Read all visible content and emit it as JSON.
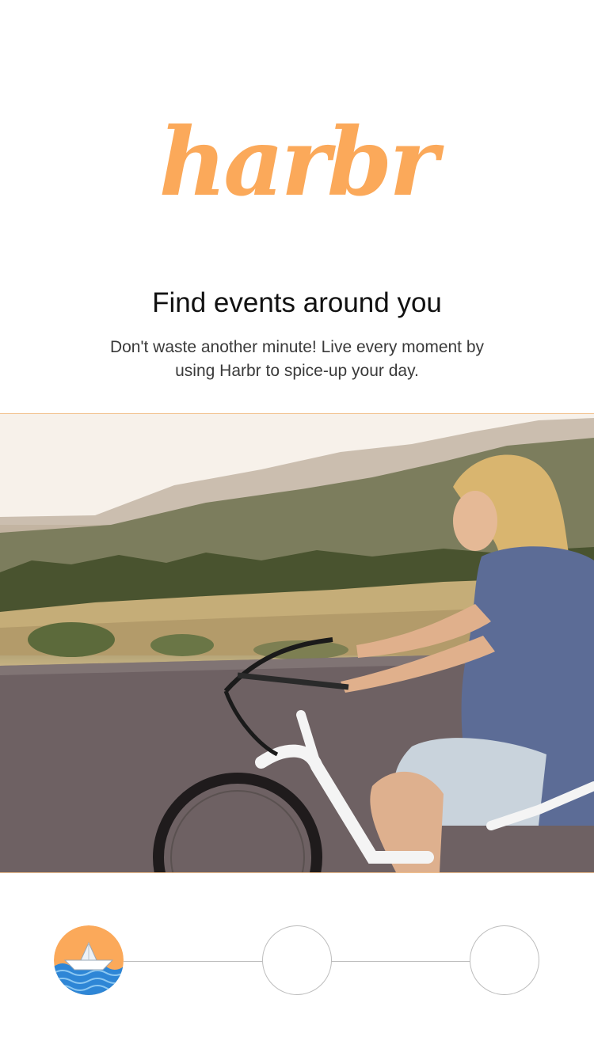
{
  "logo": {
    "text": "harbr",
    "color": "#FBA95A"
  },
  "onboarding": {
    "title": "Find events around you",
    "description": "Don't waste another minute! Live every moment by using Harbr to spice-up your day."
  },
  "hero": {
    "image": "woman-riding-bicycle-photo"
  },
  "pager": {
    "total_steps": 3,
    "current_step": 1,
    "active_icon": "paper-boat-icon"
  },
  "colors": {
    "accent": "#FBA95A",
    "pager_line": "#BDBDBD",
    "boat_water": "#2E86D6"
  }
}
